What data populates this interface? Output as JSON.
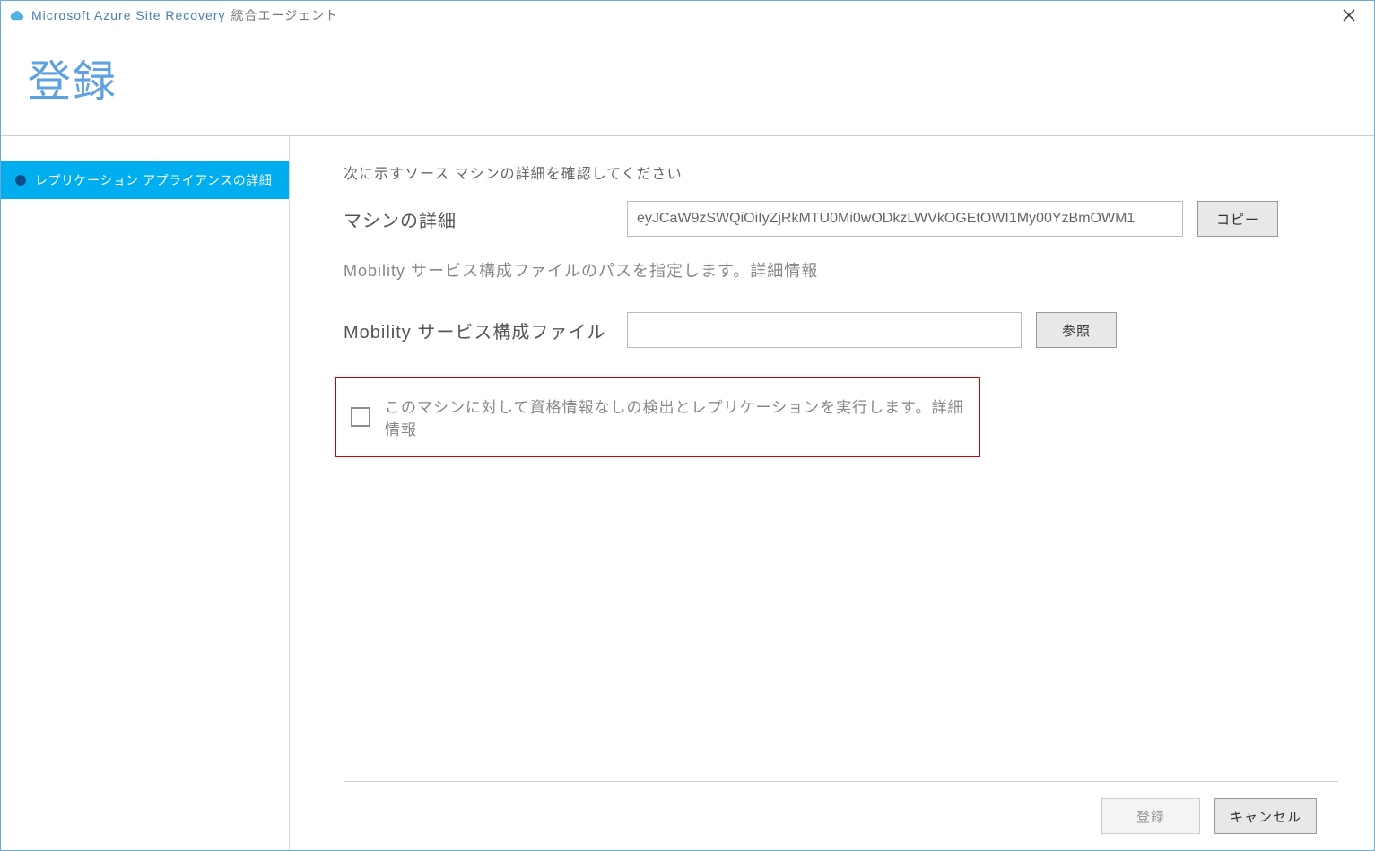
{
  "titlebar": {
    "app_name": "Microsoft Azure Site Recovery",
    "app_suffix": "統合エージェント"
  },
  "header": {
    "title": "登録"
  },
  "sidebar": {
    "items": [
      {
        "label": "レプリケーション アプライアンスの詳細",
        "active": true
      }
    ]
  },
  "main": {
    "instruction": "次に示すソース マシンの詳細を確認してください",
    "machine_details_label": "マシンの詳細",
    "machine_details_value": "eyJCaW9zSWQiOiIyZjRkMTU0Mi0wODkzLWVkOGEtOWI1My00YzBmOWM1",
    "copy_label": "コピー",
    "mobility_path_text": "Mobility サービス構成ファイルのパスを指定します。詳細情報",
    "mobility_file_label": "Mobility サービス構成ファイル",
    "mobility_file_value": "",
    "browse_label": "参照",
    "checkbox_label": "このマシンに対して資格情報なしの検出とレプリケーションを実行します。詳細情報"
  },
  "footer": {
    "register_label": "登録",
    "cancel_label": "キャンセル"
  }
}
